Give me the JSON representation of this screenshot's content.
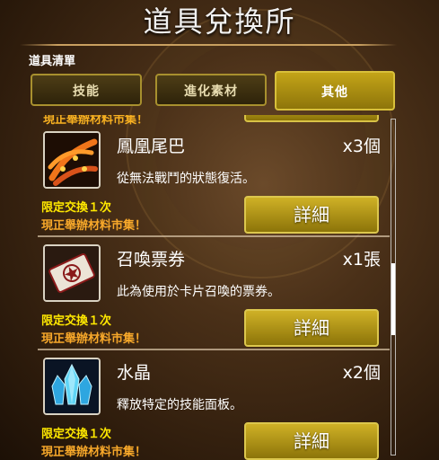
{
  "header": {
    "title": "道具兌換所"
  },
  "list_label": "道具清單",
  "tabs": [
    {
      "label": "技能",
      "active": false
    },
    {
      "label": "進化素材",
      "active": false
    },
    {
      "label": "其他",
      "active": true
    }
  ],
  "items": [
    {
      "name": "鳳凰尾巴",
      "quantity": "x3個",
      "description": "從無法戰鬥的狀態復活。",
      "limit": "限定交換１次",
      "market": "現正舉辦材料市集！",
      "button": "詳細",
      "icon": "phoenix-tail-icon"
    },
    {
      "name": "召喚票券",
      "quantity": "x1張",
      "description": "此為使用於卡片召喚的票券。",
      "limit": "限定交換１次",
      "market": "現正舉辦材料市集！",
      "button": "詳細",
      "icon": "summon-ticket-icon"
    },
    {
      "name": "水晶",
      "quantity": "x2個",
      "description": "釋放特定的技能面板。",
      "limit": "限定交換１次",
      "market": "現正舉辦材料市集！",
      "button": "詳細",
      "icon": "crystal-icon"
    }
  ],
  "partial_top_text": "現正舉辦材料市集！",
  "colors": {
    "accent_gold": "#c3a418",
    "limit_yellow": "#ffe800",
    "market_orange": "#f7a82a"
  }
}
